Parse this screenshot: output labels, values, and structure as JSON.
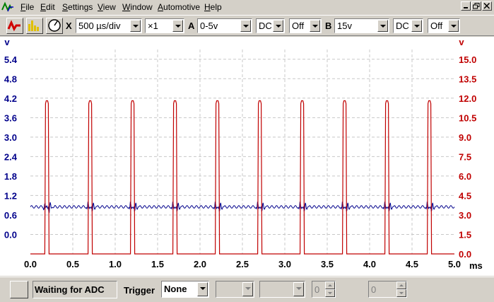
{
  "menu": {
    "items": [
      {
        "label": "File",
        "underline": "F",
        "rest": "ile"
      },
      {
        "label": "Edit",
        "underline": "E",
        "rest": "dit"
      },
      {
        "label": "Settings",
        "underline": "S",
        "rest": "ettings"
      },
      {
        "label": "View",
        "underline": "V",
        "rest": "iew"
      },
      {
        "label": "Window",
        "underline": "W",
        "rest": "indow"
      },
      {
        "label": "Automotive",
        "underline": "A",
        "rest": "utomotive"
      },
      {
        "label": "Help",
        "underline": "H",
        "rest": "elp"
      }
    ]
  },
  "toolbar": {
    "x_label": "X",
    "timebase": "500 µs/div",
    "multiplier": "×1",
    "a_label": "A",
    "a_range": "0-5v",
    "a_coupling": "DC",
    "a_option": "Off",
    "b_label": "B",
    "b_range": "15v",
    "b_coupling": "DC",
    "b_option": "Off"
  },
  "status": {
    "text": "Waiting for ADC",
    "trigger_label": "Trigger",
    "trigger_mode": "None",
    "spin1_value": "0",
    "spin2_value": "0"
  },
  "colors": {
    "channel_a": "#00008b",
    "channel_b": "#c00000",
    "grid": "#c8c8c8"
  },
  "chart_data": {
    "type": "line",
    "x_unit": "ms",
    "xlim": [
      0,
      5.0
    ],
    "x_ticks": [
      "0.0",
      "0.5",
      "1.0",
      "1.5",
      "2.0",
      "2.5",
      "3.0",
      "3.5",
      "4.0",
      "4.5",
      "5.0"
    ],
    "y_left": {
      "unit": "v",
      "ticks": [
        "0.0",
        "0.6",
        "1.2",
        "1.8",
        "2.4",
        "3.0",
        "3.6",
        "4.2",
        "4.8",
        "5.4"
      ],
      "range": [
        -0.6,
        5.7
      ]
    },
    "y_right": {
      "unit": "v",
      "ticks": [
        "0.0",
        "1.5",
        "3.0",
        "4.5",
        "6.0",
        "7.5",
        "9.0",
        "10.5",
        "12.0",
        "13.5",
        "15.0"
      ],
      "range": [
        0,
        15.75
      ]
    },
    "grid": true,
    "series": [
      {
        "channel": "A",
        "baseline": 0.85,
        "ripple": 0.04,
        "pulse_starts_ms": [
          0.17,
          0.68,
          1.18,
          1.68,
          2.18,
          2.68,
          3.18,
          3.68,
          4.18,
          4.68
        ]
      },
      {
        "channel": "B",
        "low": 0.0,
        "high": 11.8,
        "pulse_starts_ms": [
          0.17,
          0.68,
          1.18,
          1.68,
          2.18,
          2.68,
          3.18,
          3.68,
          4.18,
          4.68
        ],
        "pulse_width_ms": 0.05
      }
    ]
  }
}
